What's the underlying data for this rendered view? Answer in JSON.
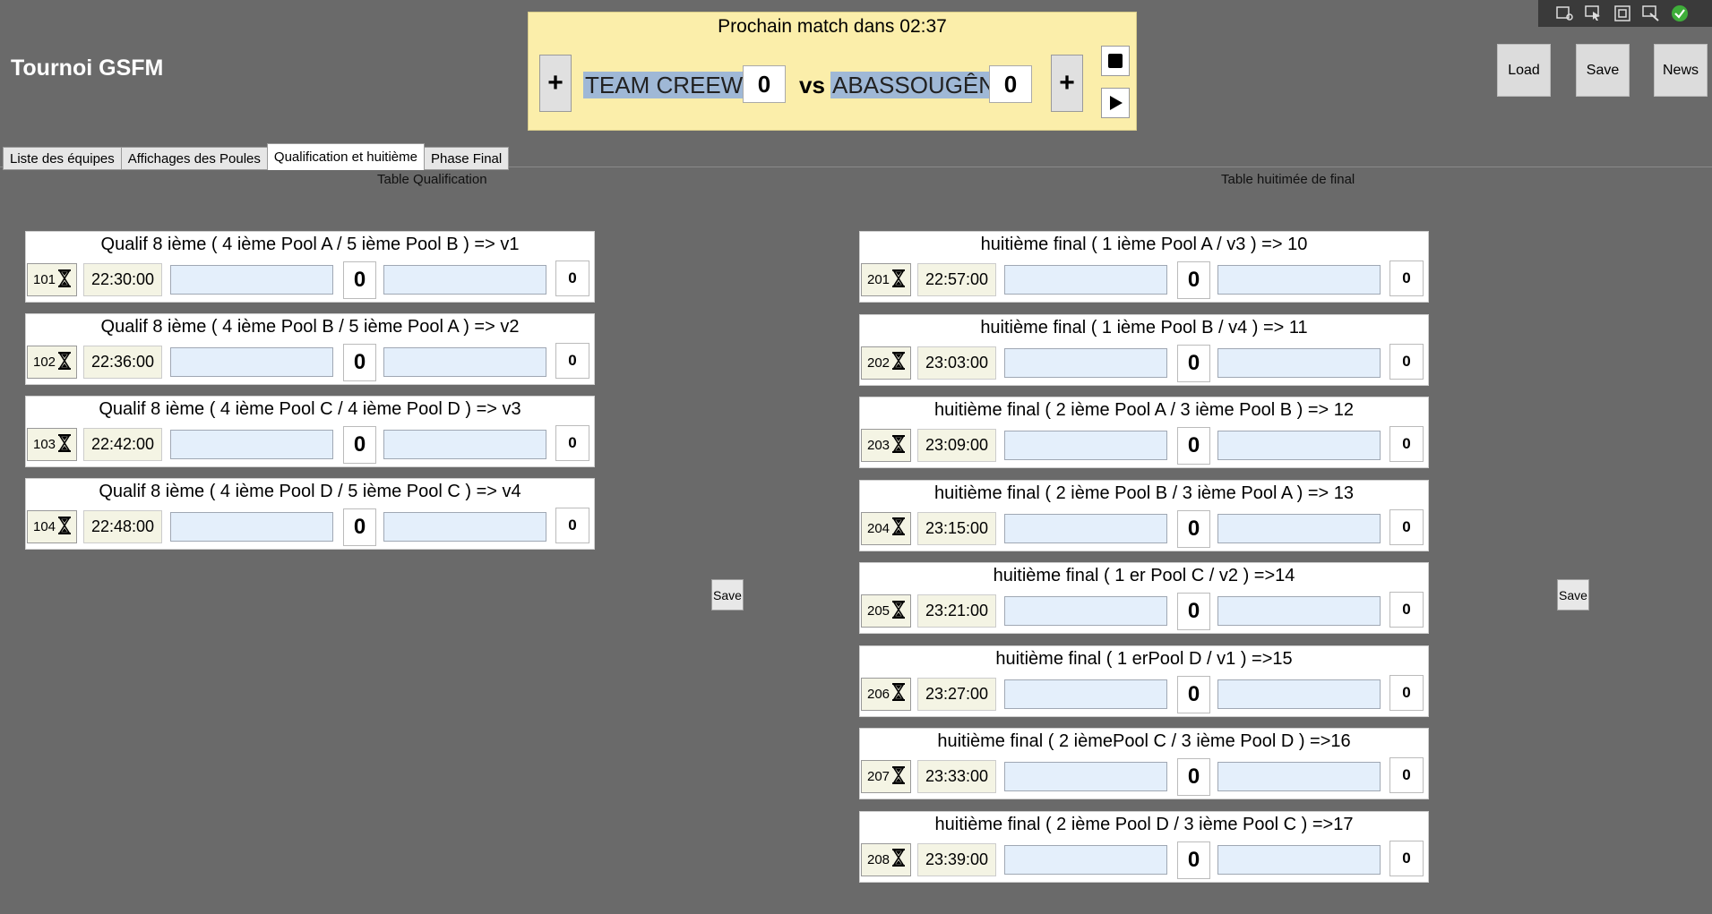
{
  "app": {
    "title": "Tournoi GSFM"
  },
  "match_panel": {
    "header": "Prochain match dans 02:37",
    "team1": "TEAM CREEWN",
    "team1_score": "0",
    "vs": "vs",
    "team2": "ABASSOUGÊNE",
    "team2_score": "0",
    "plus_label": "+"
  },
  "buttons": {
    "load": "Load",
    "save": "Save",
    "news": "News"
  },
  "tabs": [
    {
      "label": "Liste des équipes"
    },
    {
      "label": "Affichages des Poules"
    },
    {
      "label": "Qualification  et huitième"
    },
    {
      "label": "Phase Final"
    }
  ],
  "qualification": {
    "title": "Table Qualification",
    "save_label": "Save",
    "matches": [
      {
        "title": "Qualif 8 ième ( 4 ième Pool A / 5 ième Pool B ) => v1",
        "number": "101",
        "time": "22:30:00",
        "score1": "0",
        "score2": "0"
      },
      {
        "title": "Qualif 8 ième ( 4 ième Pool B / 5 ième Pool A ) => v2",
        "number": "102",
        "time": "22:36:00",
        "score1": "0",
        "score2": "0"
      },
      {
        "title": "Qualif 8 ième ( 4 ième Pool C / 4 ième Pool D ) => v3",
        "number": "103",
        "time": "22:42:00",
        "score1": "0",
        "score2": "0"
      },
      {
        "title": "Qualif 8 ième ( 4 ième Pool D / 5 ième Pool C ) => v4",
        "number": "104",
        "time": "22:48:00",
        "score1": "0",
        "score2": "0"
      }
    ]
  },
  "huitieme": {
    "title": "Table huitimée de final",
    "save_label": "Save",
    "matches": [
      {
        "title": "huitième final ( 1 ième Pool A / v3 ) => 10",
        "number": "201",
        "time": "22:57:00",
        "score1": "0",
        "score2": "0"
      },
      {
        "title": "huitième final ( 1 ième Pool B / v4 ) => 11",
        "number": "202",
        "time": "23:03:00",
        "score1": "0",
        "score2": "0"
      },
      {
        "title": "huitième final ( 2 ième Pool A / 3 ième Pool B ) => 12",
        "number": "203",
        "time": "23:09:00",
        "score1": "0",
        "score2": "0"
      },
      {
        "title": "huitième final ( 2 ième Pool B / 3 ième Pool A ) => 13",
        "number": "204",
        "time": "23:15:00",
        "score1": "0",
        "score2": "0"
      },
      {
        "title": "huitième final ( 1 er Pool C / v2 ) =>14",
        "number": "205",
        "time": "23:21:00",
        "score1": "0",
        "score2": "0"
      },
      {
        "title": "huitième final ( 1 erPool D / v1 ) =>15",
        "number": "206",
        "time": "23:27:00",
        "score1": "0",
        "score2": "0"
      },
      {
        "title": "huitième final ( 2 ièmePool C / 3 ième Pool D ) =>16",
        "number": "207",
        "time": "23:33:00",
        "score1": "0",
        "score2": "0"
      },
      {
        "title": "huitième final ( 2 ième Pool D / 3 ième Pool C ) =>17",
        "number": "208",
        "time": "23:39:00",
        "score1": "0",
        "score2": "0"
      }
    ]
  }
}
